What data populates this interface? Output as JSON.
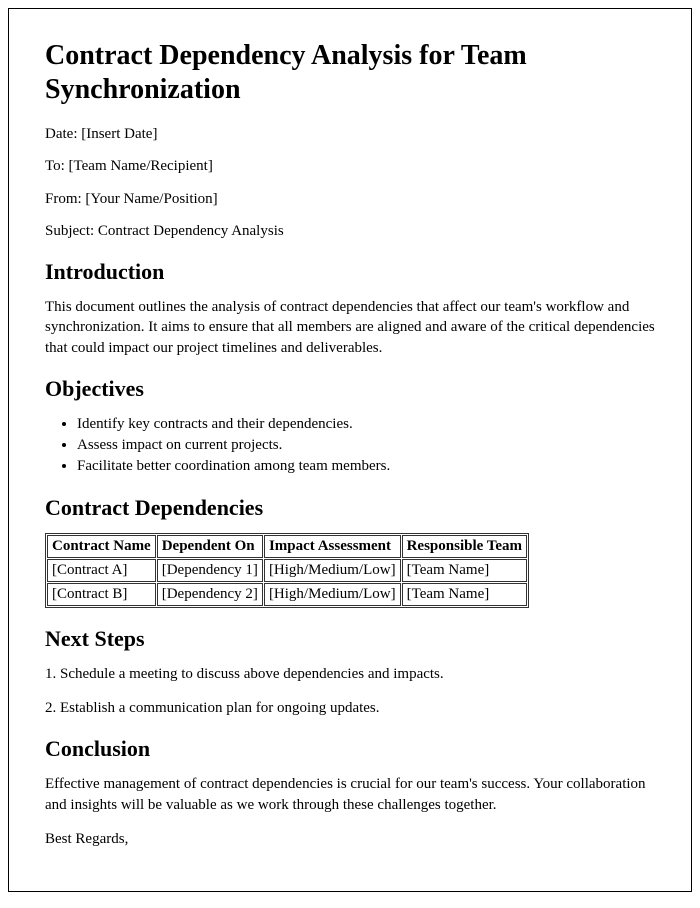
{
  "title": "Contract Dependency Analysis for Team Synchronization",
  "meta": {
    "date": "Date: [Insert Date]",
    "to": "To: [Team Name/Recipient]",
    "from": "From: [Your Name/Position]",
    "subject": "Subject: Contract Dependency Analysis"
  },
  "introduction": {
    "heading": "Introduction",
    "body": "This document outlines the analysis of contract dependencies that affect our team's workflow and synchronization. It aims to ensure that all members are aligned and aware of the critical dependencies that could impact our project timelines and deliverables."
  },
  "objectives": {
    "heading": "Objectives",
    "items": [
      "Identify key contracts and their dependencies.",
      "Assess impact on current projects.",
      "Facilitate better coordination among team members."
    ]
  },
  "dependencies": {
    "heading": "Contract Dependencies",
    "headers": [
      "Contract Name",
      "Dependent On",
      "Impact Assessment",
      "Responsible Team"
    ],
    "rows": [
      [
        "[Contract A]",
        "[Dependency 1]",
        "[High/Medium/Low]",
        "[Team Name]"
      ],
      [
        "[Contract B]",
        "[Dependency 2]",
        "[High/Medium/Low]",
        "[Team Name]"
      ]
    ]
  },
  "next_steps": {
    "heading": "Next Steps",
    "items": [
      "1. Schedule a meeting to discuss above dependencies and impacts.",
      "2. Establish a communication plan for ongoing updates."
    ]
  },
  "conclusion": {
    "heading": "Conclusion",
    "body": "Effective management of contract dependencies is crucial for our team's success. Your collaboration and insights will be valuable as we work through these challenges together.",
    "signoff": "Best Regards,"
  }
}
